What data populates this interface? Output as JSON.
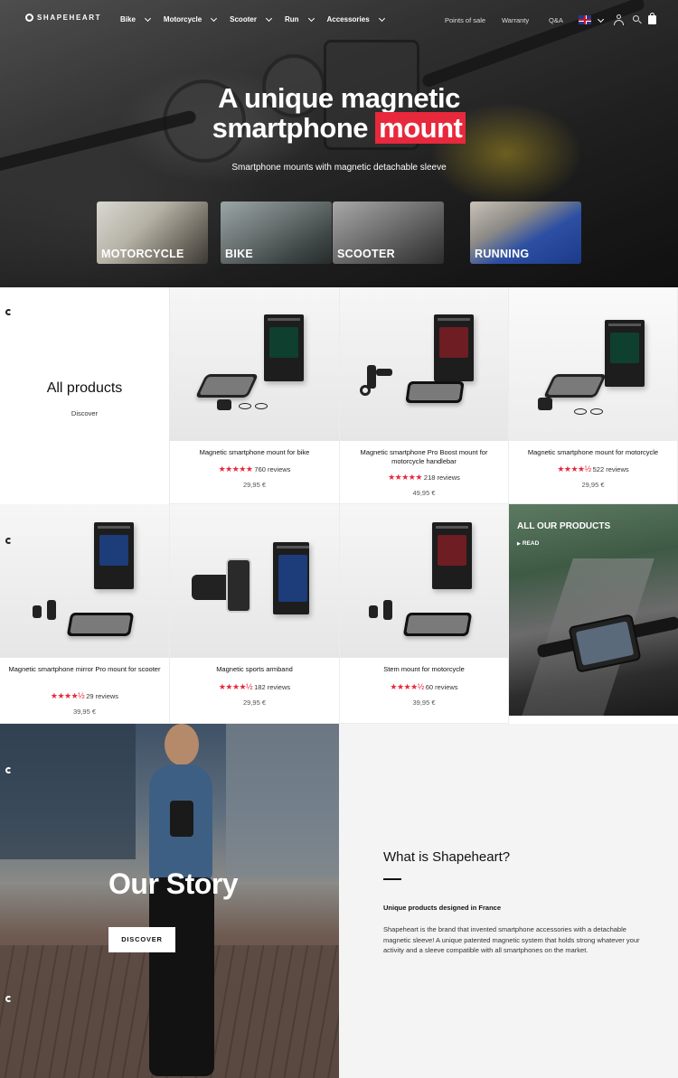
{
  "brand": {
    "name": "SHAPEHEART"
  },
  "nav": {
    "menu": [
      {
        "label": "Bike"
      },
      {
        "label": "Motorcycle"
      },
      {
        "label": "Scooter"
      },
      {
        "label": "Run"
      },
      {
        "label": "Accessories"
      }
    ],
    "utilities": {
      "points_of_sale": "Points of sale",
      "warranty": "Warranty",
      "qa": "Q&A"
    },
    "language_icon": "uk-flag-icon"
  },
  "hero": {
    "title_line1": "A unique magnetic",
    "title_line2_plain": "smartphone",
    "title_line2_highlight": "mount",
    "subtitle": "Smartphone mounts with magnetic detachable sleeve",
    "highlight_color": "#e8283c",
    "categories": [
      {
        "label": "MOTORCYCLE"
      },
      {
        "label": "BIKE"
      },
      {
        "label": "SCOOTER"
      },
      {
        "label": "RUNNING"
      }
    ]
  },
  "all_products": {
    "title": "All products",
    "link": "Discover"
  },
  "products": [
    {
      "name": "Magnetic smartphone mount for bike",
      "stars": "★★★★★",
      "reviews": "760 reviews",
      "price": "29,95 €"
    },
    {
      "name": "Magnetic smartphone Pro Boost mount for motorcycle handlebar",
      "stars": "★★★★★",
      "reviews": "218 reviews",
      "price": "49,95 €"
    },
    {
      "name": "Magnetic smartphone mount for motorcycle",
      "stars": "★★★★½",
      "reviews": "522 reviews",
      "price": "29,95 €"
    },
    {
      "name": "Magnetic smartphone mirror Pro mount for scooter",
      "stars": "★★★★½",
      "reviews": "29 reviews",
      "price": "39,95 €"
    },
    {
      "name": "Magnetic sports armband",
      "stars": "★★★★½",
      "reviews": "182 reviews",
      "price": "29,95 €"
    },
    {
      "name": "Stem mount for motorcycle",
      "stars": "★★★★½",
      "reviews": "60 reviews",
      "price": "39,95 €"
    }
  ],
  "promo": {
    "title": "ALL OUR PRODUCTS",
    "link": "READ"
  },
  "story": {
    "title": "Our Story",
    "button": "DISCOVER"
  },
  "about": {
    "title": "What is Shapeheart?",
    "tagline": "Unique products designed in France",
    "description": "Shapeheart is the brand that invented smartphone accessories with a detachable magnetic sleeve! A unique patented magnetic system that holds strong whatever your activity and a sleeve compatible with all smartphones on the market."
  }
}
